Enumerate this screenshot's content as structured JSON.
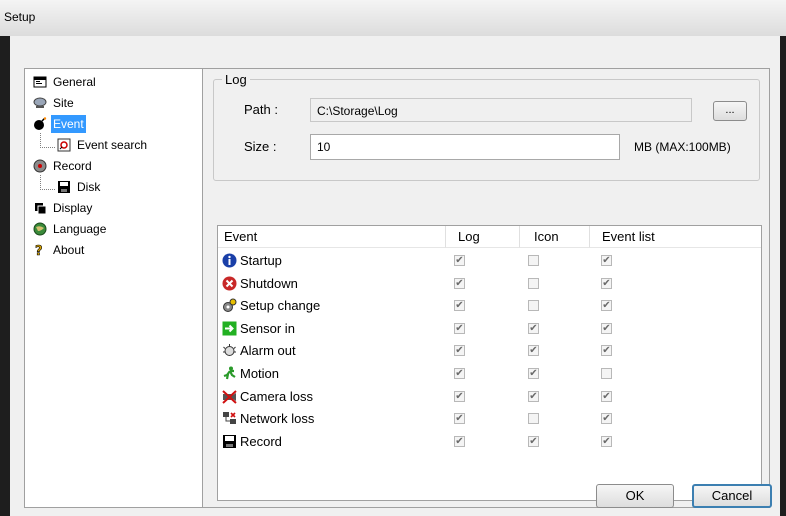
{
  "window": {
    "title": "Setup"
  },
  "tree": {
    "items": [
      {
        "label": "General",
        "icon": "general-icon"
      },
      {
        "label": "Site",
        "icon": "site-icon"
      },
      {
        "label": "Event",
        "icon": "event-bomb-icon",
        "selected": true
      },
      {
        "label": "Event search",
        "icon": "event-search-icon"
      },
      {
        "label": "Record",
        "icon": "record-icon"
      },
      {
        "label": "Disk",
        "icon": "disk-icon"
      },
      {
        "label": "Display",
        "icon": "display-icon"
      },
      {
        "label": "Language",
        "icon": "language-globe-icon"
      },
      {
        "label": "About",
        "icon": "about-question-icon"
      }
    ]
  },
  "log": {
    "legend": "Log",
    "path_label": "Path :",
    "path_value": "C:\\Storage\\Log",
    "browse_label": "...",
    "size_label": "Size :",
    "size_value": "10",
    "size_unit": "MB  (MAX:100MB)"
  },
  "table": {
    "headers": [
      "Event",
      "Log",
      "Icon",
      "Event list"
    ],
    "rows": [
      {
        "name": "Startup",
        "icon": "info-icon",
        "log": true,
        "icon_on": false,
        "list": true
      },
      {
        "name": "Shutdown",
        "icon": "shutdown-icon",
        "log": true,
        "icon_on": false,
        "list": true
      },
      {
        "name": "Setup change",
        "icon": "setup-change-icon",
        "log": true,
        "icon_on": false,
        "list": true
      },
      {
        "name": "Sensor in",
        "icon": "sensor-in-icon",
        "log": true,
        "icon_on": true,
        "list": true
      },
      {
        "name": "Alarm out",
        "icon": "alarm-out-icon",
        "log": true,
        "icon_on": true,
        "list": true
      },
      {
        "name": "Motion",
        "icon": "motion-icon",
        "log": true,
        "icon_on": true,
        "list": false
      },
      {
        "name": "Camera loss",
        "icon": "camera-loss-icon",
        "log": true,
        "icon_on": true,
        "list": true
      },
      {
        "name": "Network loss",
        "icon": "network-loss-icon",
        "log": true,
        "icon_on": false,
        "list": true
      },
      {
        "name": "Record",
        "icon": "record-disk-icon",
        "log": true,
        "icon_on": true,
        "list": true
      }
    ]
  },
  "buttons": {
    "ok": "OK",
    "cancel": "Cancel"
  },
  "colors": {
    "selection": "#3399ff",
    "cancel_border": "#3c7fb1"
  }
}
